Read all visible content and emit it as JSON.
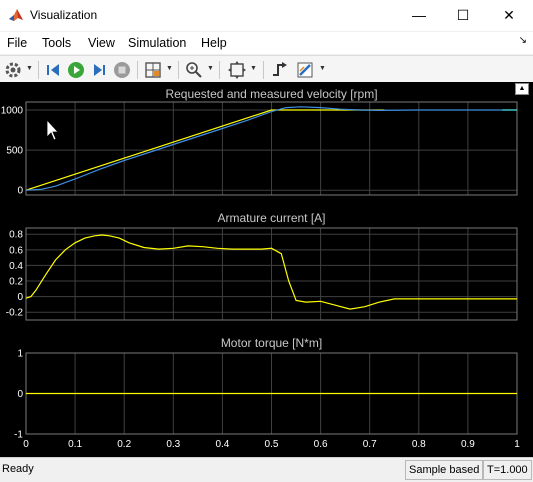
{
  "window": {
    "title": "Visualization",
    "minimize_glyph": "—",
    "maximize_glyph": "☐",
    "close_glyph": "✕"
  },
  "menu": [
    "File",
    "Tools",
    "View",
    "Simulation",
    "Help"
  ],
  "toolbar_icons": [
    "settings-icon",
    "step-back-icon",
    "run-icon",
    "step-forward-icon",
    "stop-icon",
    "layout-icon",
    "zoom-icon",
    "autoscale-icon",
    "trigger-icon",
    "style-icon"
  ],
  "status": {
    "ready": "Ready",
    "mode": "Sample based",
    "time": "T=1.000"
  },
  "colors": {
    "background": "#000000",
    "grid": "#404040",
    "yellow": "#ffff00",
    "blue": "#3f8fdf",
    "cyan": "#40e0d0"
  },
  "chart_data": [
    {
      "type": "line",
      "title": "Requested and measured velocity [rpm]",
      "xlim": [
        0,
        1
      ],
      "ylim": [
        -60,
        1100
      ],
      "yticks": [
        0,
        500,
        1000
      ],
      "ytick_labels": [
        "0",
        "500",
        "1000"
      ],
      "grid": true,
      "series": [
        {
          "color": "#ffff00",
          "x": [
            0,
            0.5,
            0.73
          ],
          "y": [
            0,
            1000,
            1000
          ]
        },
        {
          "color": "#3f8fdf",
          "x": [
            0,
            0.03,
            0.06,
            0.1,
            0.15,
            0.2,
            0.25,
            0.3,
            0.35,
            0.4,
            0.45,
            0.5,
            0.53,
            0.56,
            0.6,
            0.64,
            0.68,
            0.72,
            0.8,
            0.9,
            1.0
          ],
          "y": [
            0,
            10,
            50,
            140,
            260,
            370,
            470,
            570,
            670,
            770,
            870,
            980,
            1030,
            1040,
            1030,
            1010,
            1000,
            995,
            1000,
            1000,
            1000
          ]
        },
        {
          "color": "#40e0d0",
          "x": [
            0.97,
            1.0
          ],
          "y": [
            1000,
            1000
          ]
        }
      ]
    },
    {
      "type": "line",
      "title": "Armature current [A]",
      "xlim": [
        0,
        1
      ],
      "ylim": [
        -0.3,
        0.88
      ],
      "yticks": [
        -0.2,
        0,
        0.2,
        0.4,
        0.6,
        0.8
      ],
      "ytick_labels": [
        "-0.2",
        "0",
        "0.2",
        "0.4",
        "0.6",
        "0.8"
      ],
      "grid": true,
      "series": [
        {
          "color": "#ffff00",
          "x": [
            0,
            0.01,
            0.02,
            0.04,
            0.06,
            0.08,
            0.1,
            0.12,
            0.14,
            0.155,
            0.17,
            0.19,
            0.21,
            0.24,
            0.27,
            0.3,
            0.33,
            0.36,
            0.39,
            0.42,
            0.45,
            0.48,
            0.5,
            0.52,
            0.535,
            0.55,
            0.57,
            0.6,
            0.63,
            0.66,
            0.69,
            0.72,
            0.75,
            0.8,
            0.9,
            1.0
          ],
          "y": [
            -0.02,
            0.0,
            0.08,
            0.28,
            0.47,
            0.6,
            0.69,
            0.75,
            0.78,
            0.79,
            0.78,
            0.75,
            0.69,
            0.63,
            0.61,
            0.62,
            0.65,
            0.64,
            0.62,
            0.61,
            0.61,
            0.61,
            0.62,
            0.55,
            0.2,
            -0.05,
            -0.07,
            -0.06,
            -0.11,
            -0.16,
            -0.13,
            -0.07,
            -0.03,
            -0.03,
            -0.03,
            -0.03
          ]
        }
      ]
    },
    {
      "type": "line",
      "title": "Motor torque [N*m]",
      "xlim": [
        0,
        1
      ],
      "ylim": [
        -1,
        1
      ],
      "yticks": [
        -1,
        0,
        1
      ],
      "ytick_labels": [
        "-1",
        "0",
        "1"
      ],
      "xticks": [
        0,
        0.1,
        0.2,
        0.3,
        0.4,
        0.5,
        0.6,
        0.7,
        0.8,
        0.9,
        1
      ],
      "xtick_labels": [
        "0",
        "0.1",
        "0.2",
        "0.3",
        "0.4",
        "0.5",
        "0.6",
        "0.7",
        "0.8",
        "0.9",
        "1"
      ],
      "grid": true,
      "series": [
        {
          "color": "#ffff00",
          "x": [
            0,
            1
          ],
          "y": [
            0,
            0
          ]
        }
      ]
    }
  ]
}
